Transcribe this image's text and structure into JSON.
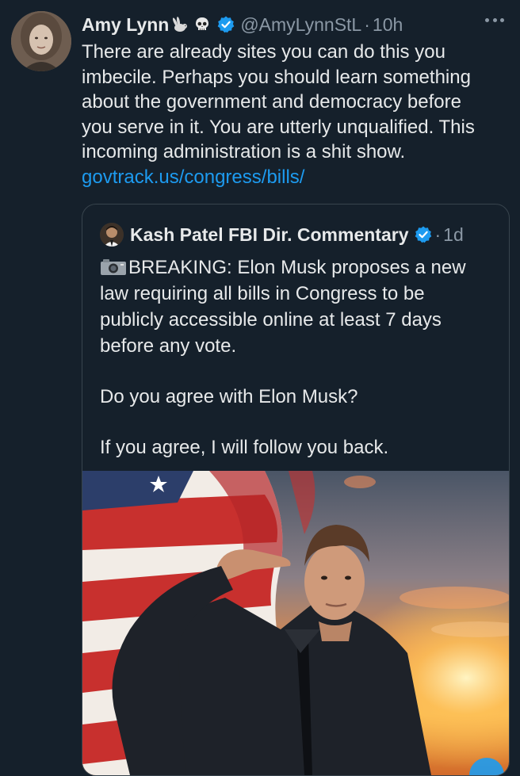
{
  "tweet": {
    "author_name": "Amy Lynn",
    "author_handle": "@AmyLynnStL",
    "separator": "·",
    "time": "10h",
    "emoji_icons": [
      "rabbit-icon",
      "skull-icon"
    ],
    "verified_icon": "verified-badge-icon",
    "more_icon": "more-options-icon",
    "text_lines": [
      "There are already sites you can do this you",
      "imbecile. Perhaps you should learn something",
      "about the government and democracy before",
      "you serve in it. You are utterly unqualified. This",
      "incoming administration is a shit show."
    ],
    "link": "govtrack.us/congress/bills/"
  },
  "quoted_tweet": {
    "author_name": "Kash Patel FBI Dir. Commentary",
    "separator": "·",
    "time": "1d",
    "verified_icon": "verified-badge-icon",
    "camera_icon": "camera-icon",
    "text_lines": [
      "BREAKING: Elon Musk proposes a new",
      "law requiring all bills in Congress to be",
      "publicly accessible online at least 7 days",
      "before any vote."
    ],
    "question": "Do you agree with Elon Musk?",
    "follow_text": "If you agree, I will follow you back.",
    "image_alt_icon": "saluting-man-flag-sunset-photo"
  },
  "colors": {
    "background": "#15202b",
    "text": "#e7e9ea",
    "secondary": "#8b98a5",
    "link": "#1d9bf0",
    "border": "#38444d"
  }
}
